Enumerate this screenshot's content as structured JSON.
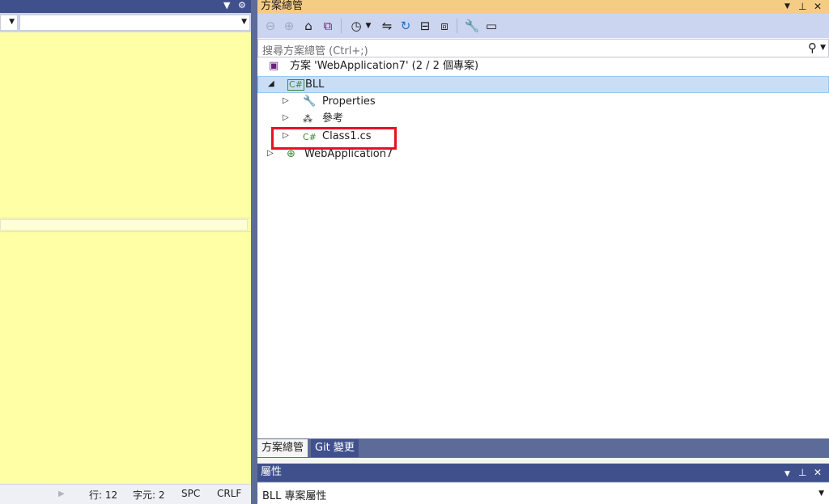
{
  "left_panel": {
    "status": {
      "line": "行: 12",
      "char": "字元: 2",
      "spc": "SPC",
      "crlf": "CRLF"
    }
  },
  "solution_explorer": {
    "title": "方案總管",
    "search_placeholder": "搜尋方案總管 (Ctrl+;)",
    "tree": {
      "solution": "方案 'WebApplication7' (2 / 2 個專案)",
      "bll": "BLL",
      "properties": "Properties",
      "references": "參考",
      "class1": "Class1.cs",
      "webapp": "WebApplication7"
    },
    "tabs": [
      "方案總管",
      "Git 變更"
    ]
  },
  "properties_panel": {
    "title": "屬性",
    "selected": "BLL  專案屬性"
  },
  "colors": {
    "editor_bg": "#ffffa6",
    "highlight_box": "#e81123",
    "active_title": "#f5cc84",
    "inactive_title": "#40508d",
    "selected_row": "#c9def5"
  },
  "icons": {
    "back": "back-arrow-icon",
    "forward": "forward-arrow-icon",
    "home": "home-icon",
    "switch_views": "switch-views-icon",
    "pending_changes": "clock-icon",
    "sync": "sync-icon",
    "refresh": "refresh-icon",
    "collapse": "collapse-all-icon",
    "show_all": "show-all-files-icon",
    "properties": "wrench-icon",
    "preview": "preview-icon",
    "search": "search-icon"
  }
}
